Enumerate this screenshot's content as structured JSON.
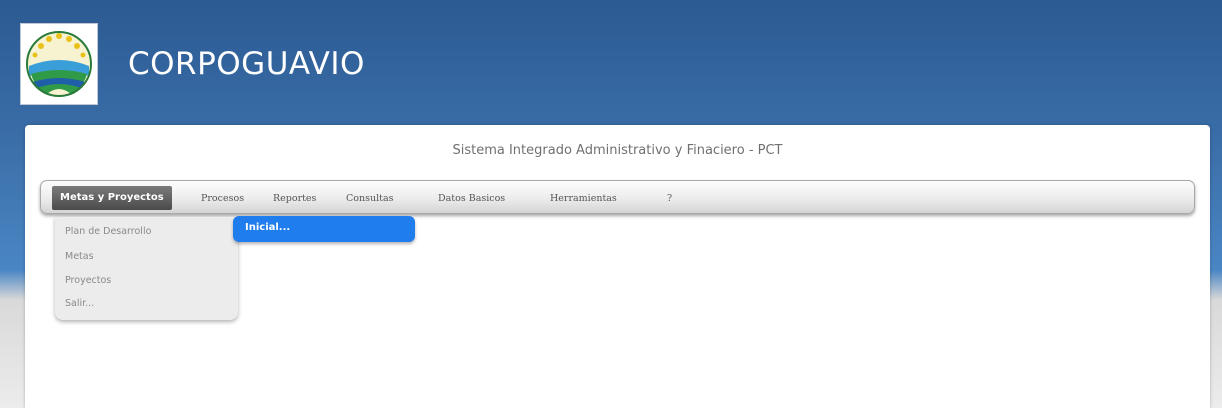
{
  "app": {
    "name": "CORPOGUAVIO",
    "subtitle": "Sistema Integrado Administrativo y Finaciero - PCT"
  },
  "menu": {
    "items": [
      {
        "label": "Metas y Proyectos",
        "active": true
      },
      {
        "label": "Procesos"
      },
      {
        "label": "Reportes"
      },
      {
        "label": "Consultas"
      },
      {
        "label": "Datos Basicos"
      },
      {
        "label": "Herramientas"
      },
      {
        "label": "?"
      }
    ]
  },
  "dropdown": {
    "items": [
      {
        "label": "Plan de Desarrollo"
      },
      {
        "label": "Metas"
      },
      {
        "label": "Proyectos"
      },
      {
        "label": "Salir..."
      }
    ]
  },
  "submenu": {
    "items": [
      {
        "label": "Inicial..."
      }
    ]
  },
  "colors": {
    "header_blue": "#2c5a92",
    "menu_active": "#4a4a4a",
    "submenu_highlight": "#1f7dee"
  }
}
